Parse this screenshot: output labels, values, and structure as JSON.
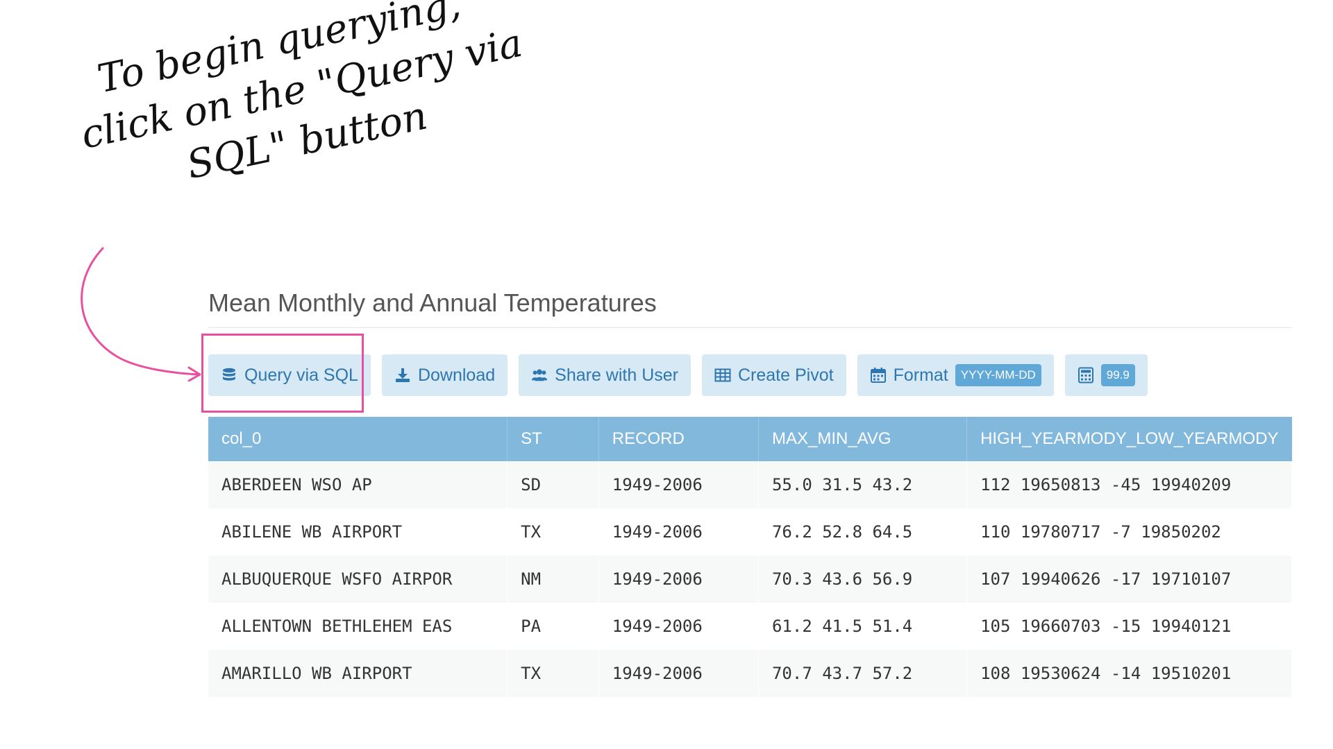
{
  "annotation": {
    "line1": "To begin querying,",
    "line2": "click on the \"Query via",
    "line3": "SQL\" button"
  },
  "panel": {
    "title": "Mean Monthly and Annual Temperatures"
  },
  "toolbar": {
    "query_sql_label": "Query via SQL",
    "download_label": "Download",
    "share_label": "Share with User",
    "pivot_label": "Create Pivot",
    "format_label": "Format",
    "format_badge": "YYYY-MM-DD",
    "number_badge": "99.9"
  },
  "colors": {
    "accent": "#2e76b0",
    "button_bg": "#d6e9f5",
    "header_bg": "#82b8dc",
    "highlight": "#e94fa0"
  },
  "icons": {
    "query_sql": "database-icon",
    "download": "download-icon",
    "share": "users-icon",
    "pivot": "table-icon",
    "format": "calendar-icon",
    "number": "calculator-icon"
  },
  "table": {
    "columns": [
      "col_0",
      "ST",
      "RECORD",
      "MAX_MIN_AVG",
      "HIGH_YEARMODY_LOW_YEARMODY"
    ],
    "rows": [
      [
        "ABERDEEN WSO AP",
        "SD",
        "1949-2006",
        "55.0 31.5 43.2",
        "112 19650813 -45 19940209"
      ],
      [
        "ABILENE WB AIRPORT",
        "TX",
        "1949-2006",
        "76.2 52.8 64.5",
        "110 19780717 -7 19850202"
      ],
      [
        "ALBUQUERQUE WSFO AIRPOR",
        "NM",
        "1949-2006",
        "70.3 43.6 56.9",
        "107 19940626 -17 19710107"
      ],
      [
        "ALLENTOWN BETHLEHEM EAS",
        "PA",
        "1949-2006",
        "61.2 41.5 51.4",
        "105 19660703 -15 19940121"
      ],
      [
        "AMARILLO WB AIRPORT",
        "TX",
        "1949-2006",
        "70.7 43.7 57.2",
        "108 19530624 -14 19510201"
      ]
    ]
  }
}
